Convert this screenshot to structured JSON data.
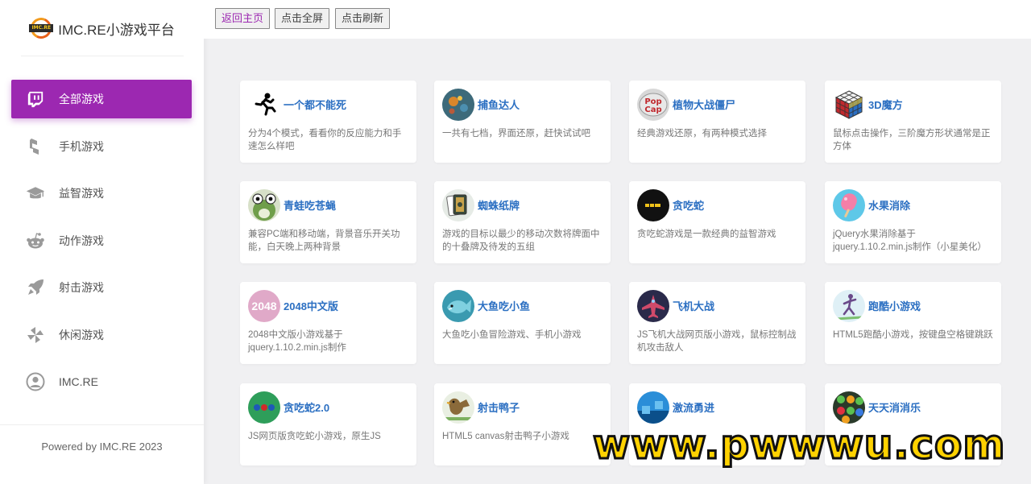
{
  "sidebar": {
    "brand": "IMC.RE小游戏平台",
    "brand_logo": "imcre-logo",
    "items": [
      {
        "label": "全部游戏",
        "icon": "twitch-icon",
        "active": true
      },
      {
        "label": "手机游戏",
        "icon": "phone-game-icon",
        "active": false
      },
      {
        "label": "益智游戏",
        "icon": "graduation-cap-icon",
        "active": false
      },
      {
        "label": "动作游戏",
        "icon": "reddit-icon",
        "active": false
      },
      {
        "label": "射击游戏",
        "icon": "rocket-icon",
        "active": false
      },
      {
        "label": "休闲游戏",
        "icon": "pinwheel-icon",
        "active": false
      },
      {
        "label": "IMC.RE",
        "icon": "user-icon",
        "active": false
      }
    ],
    "footer": "Powered by IMC.RE 2023"
  },
  "toolbar": {
    "home": "返回主页",
    "fullscreen": "点击全屏",
    "refresh": "点击刷新"
  },
  "games": [
    {
      "title": "一个都不能死",
      "desc": "分为4个模式，看看你的反应能力和手速怎么样吧",
      "icon": "runner-icon"
    },
    {
      "title": "捕鱼达人",
      "desc": "一共有七档，界面还原，赶快试试吧",
      "icon": "fish-icon"
    },
    {
      "title": "植物大战僵尸",
      "desc": "经典游戏还原，有两种模式选择",
      "icon": "popcap-icon"
    },
    {
      "title": "3D魔方",
      "desc": "鼠标点击操作，三阶魔方形状通常是正方体",
      "icon": "rubiks-cube-icon"
    },
    {
      "title": "青蛙吃苍蝇",
      "desc": "兼容PC端和移动端，背景音乐开关功能，白天晚上两种背景",
      "icon": "frog-icon"
    },
    {
      "title": "蜘蛛纸牌",
      "desc": "游戏的目标以最少的移动次数将牌面中的十叠牌及待发的五组",
      "icon": "cards-icon"
    },
    {
      "title": "贪吃蛇",
      "desc": "贪吃蛇游戏是一款经典的益智游戏",
      "icon": "snake-icon"
    },
    {
      "title": "水果消除",
      "desc": "jQuery水果消除基于jquery.1.10.2.min.js制作（小星美化）",
      "icon": "popsicle-icon"
    },
    {
      "title": "2048中文版",
      "desc": "2048中文版小游戏基于jquery.1.10.2.min.js制作",
      "icon": "2048-icon",
      "icon_text": "2048"
    },
    {
      "title": "大鱼吃小鱼",
      "desc": "大鱼吃小鱼冒险游戏、手机小游戏",
      "icon": "big-fish-icon"
    },
    {
      "title": "飞机大战",
      "desc": "JS飞机大战网页版小游戏，鼠标控制战机攻击敌人",
      "icon": "plane-icon"
    },
    {
      "title": "跑酷小游戏",
      "desc": "HTML5跑酷小游戏，按键盘空格键跳跃",
      "icon": "parkour-icon"
    },
    {
      "title": "贪吃蛇2.0",
      "desc": "JS网页版贪吃蛇小游戏，原生JS",
      "icon": "snake2-icon"
    },
    {
      "title": "射击鸭子",
      "desc": "HTML5 canvas射击鸭子小游戏",
      "icon": "duck-icon"
    },
    {
      "title": "激流勇进",
      "desc": "",
      "icon": "rapids-icon"
    },
    {
      "title": "天天消消乐",
      "desc": "",
      "icon": "match-icon"
    }
  ],
  "watermark": "www.pwwwu.com",
  "colors": {
    "accent": "#9c28b1",
    "title_blue": "#2b6fc2",
    "background": "#f0f0f2"
  }
}
